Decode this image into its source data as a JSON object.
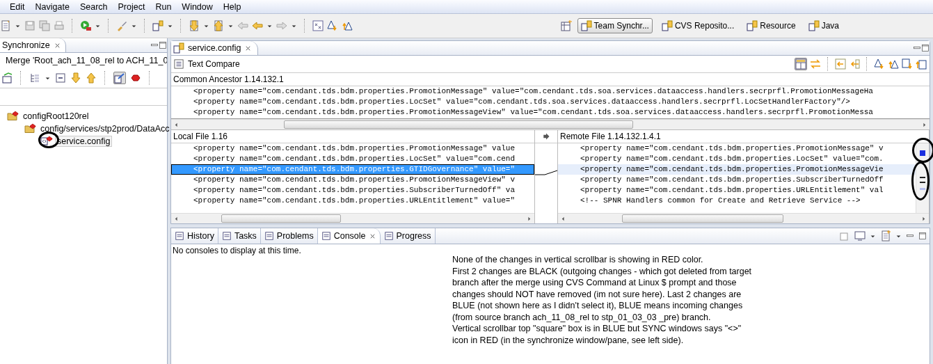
{
  "menu": [
    "Edit",
    "Navigate",
    "Search",
    "Project",
    "Run",
    "Window",
    "Help"
  ],
  "perspectives": [
    {
      "label": "Team Synchr...",
      "selected": true
    },
    {
      "label": "CVS Reposito...",
      "selected": false
    },
    {
      "label": "Resource",
      "selected": false
    },
    {
      "label": "Java",
      "selected": false
    }
  ],
  "synchronize_view": {
    "title": "Synchronize",
    "subtitle": "Merge 'Root_ach_11_08_rel to ACH_11_0",
    "tree": [
      {
        "label": "configRoot120rel",
        "selected": false,
        "children": [
          {
            "label": "config/services/stp2prod/DataAcc",
            "selected": false,
            "children": [
              {
                "label": "service.config",
                "selected": true
              }
            ]
          }
        ]
      }
    ]
  },
  "editor": {
    "tab": "service.config",
    "compare_title": "Text Compare",
    "ancestor": {
      "label": "Common Ancestor 1.14.132.1",
      "lines": [
        "<property name=\"com.cendant.tds.bdm.properties.PromotionMessage\" value=\"com.cendant.tds.soa.services.dataaccess.handlers.secrprfl.PromotionMessageHa",
        "<property name=\"com.cendant.tds.bdm.properties.LocSet\" value=\"com.cendant.tds.soa.services.dataaccess.handlers.secrprfl.LocSetHandlerFactory\"/>",
        "<property name=\"com.cendant.tds.bdm.properties.PromotionMessageView\" value=\"com.cendant.tds.soa.services.dataaccess.handlers.secrprfl.PromotionMessa"
      ]
    },
    "local": {
      "label": "Local File 1.16",
      "lines": [
        {
          "text": "<property name=\"com.cendant.tds.bdm.properties.PromotionMessage\" value",
          "selected": false
        },
        {
          "text": "<property name=\"com.cendant.tds.bdm.properties.LocSet\" value=\"com.cend",
          "selected": false
        },
        {
          "text": "<property name=\"com.cendant.tds.bdm.properties.GTIDGovernance\" value=\"",
          "selected": true
        },
        {
          "text": "<property name=\"com.cendant.tds.bdm.properties.PromotionMessageView\" v",
          "selected": false
        },
        {
          "text": "<property name=\"com.cendant.tds.bdm.properties.SubscriberTurnedOff\" va",
          "selected": false
        },
        {
          "text": "<property name=\"com.cendant.tds.bdm.properties.URLEntitlement\" value=\"",
          "selected": false
        }
      ]
    },
    "remote": {
      "label": "Remote File 1.14.132.1.4.1",
      "lines": [
        {
          "text": "<property name=\"com.cendant.tds.bdm.properties.PromotionMessage\" v",
          "selected": false
        },
        {
          "text": "<property name=\"com.cendant.tds.bdm.properties.LocSet\" value=\"com.",
          "selected": false
        },
        {
          "text": "<property name=\"com.cendant.tds.bdm.properties.PromotionMessageVie",
          "selected": true
        },
        {
          "text": "<property name=\"com.cendant.tds.bdm.properties.SubscriberTurnedOff",
          "selected": false
        },
        {
          "text": "<property name=\"com.cendant.tds.bdm.properties.URLEntitlement\" val",
          "selected": false
        },
        {
          "text": "<!-- SPNR Handlers common for Create and Retrieve Service -->",
          "selected": false
        }
      ]
    }
  },
  "bottom_panel": {
    "tabs": [
      {
        "label": "History",
        "selected": false
      },
      {
        "label": "Tasks",
        "selected": false
      },
      {
        "label": "Problems",
        "selected": false
      },
      {
        "label": "Console",
        "selected": true
      },
      {
        "label": "Progress",
        "selected": false
      }
    ],
    "message": "No consoles to display at this time."
  },
  "note": [
    "None of the changes in vertical scrollbar is showing in RED color.",
    "First 2 changes are BLACK (outgoing changes - which got deleted from target branch after the merge using CVS Command at Linux $ prompt and those changes should NOT have removed (im not sure here). Last 2 changes are BLUE (not shown here as I didn't select it), BLUE means incoming changes (from source branch ach_11_08_rel to stp_01_03_03 _pre) branch.",
    "Vertical scrollbar top \"square\" box is in BLUE but SYNC windows says \"<>\" icon in RED (in the synchronize window/pane, see left side)."
  ]
}
